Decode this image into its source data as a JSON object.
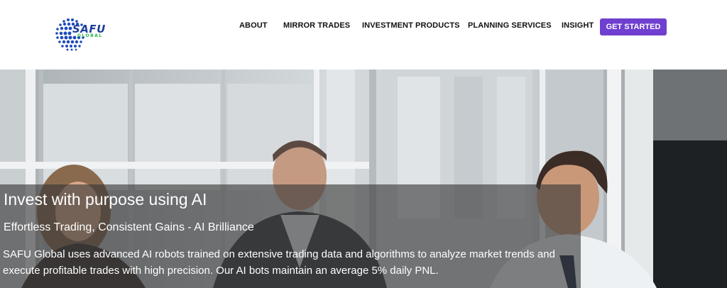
{
  "brand": {
    "name": "SAFU",
    "sub": "GLOBAL",
    "logo_icon": "globe-dots-icon"
  },
  "nav": {
    "items": [
      {
        "label": "ABOUT"
      },
      {
        "label": "MIRROR TRADES"
      },
      {
        "label": "INVESTMENT PRODUCTS"
      },
      {
        "label": "PLANNING SERVICES"
      },
      {
        "label": "INSIGHT"
      }
    ],
    "cta_label": "GET STARTED"
  },
  "hero": {
    "title": "Invest with purpose using AI",
    "subtitle": "Effortless Trading, Consistent Gains - AI Brilliance",
    "description": "SAFU Global uses advanced AI robots trained on extensive trading data and algorithms to analyze market trends and execute profitable trades with high precision. Our AI bots maintain an average 5% daily PNL.",
    "image": "office-meeting-photo"
  },
  "colors": {
    "accent": "#6f3fcf",
    "brand_blue": "#1c3f9c",
    "brand_green": "#2cb34a"
  }
}
